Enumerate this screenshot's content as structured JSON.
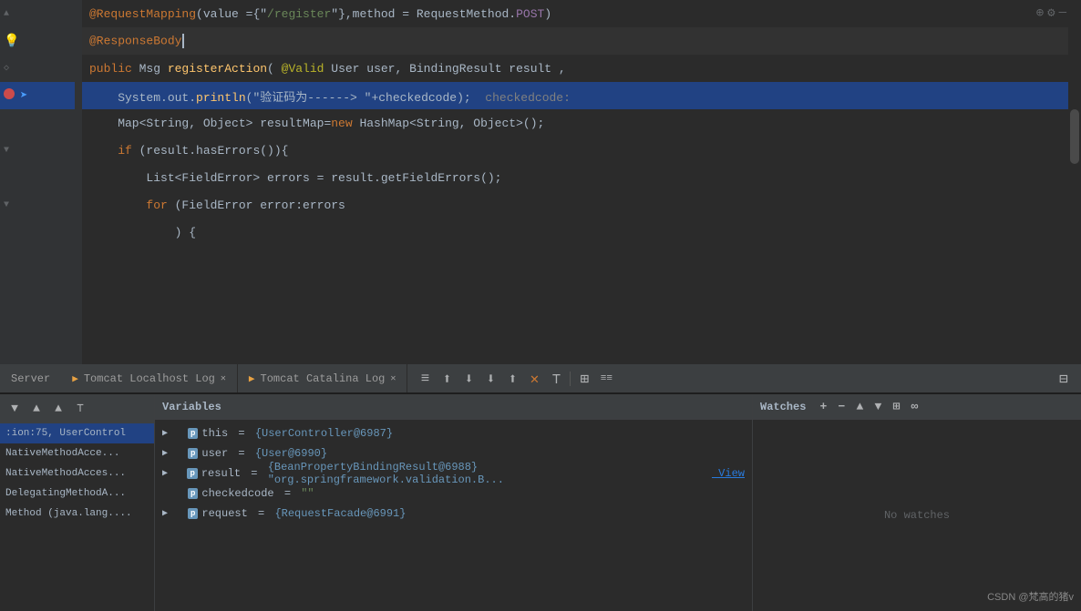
{
  "editor": {
    "lines": [
      {
        "gutter_label": "",
        "code": "<span class='kw-annotation'>@RequestMapping</span><span class='kw-gray'>(value ={\"</span><span class='kw-string'>/register</span><span class='kw-gray'>\"}</span><span class='kw-gray'>,method = RequestMethod.</span><span class='kw-purple'>POST</span><span class='kw-gray'>)</span>",
        "has_fold_arrow": true,
        "fold_direction": "up"
      },
      {
        "gutter_label": "",
        "code": "<span class='kw-annotation'>@ResponseBody</span>",
        "has_bulb": true,
        "is_active": true
      },
      {
        "gutter_label": "",
        "code": "<span class='kw-public'>public</span> <span class='kw-gray'>Msg</span> <span class='kw-method'>registerAction</span><span class='kw-gray'>( </span><span class='kw-annotation-name'>@Valid</span><span class='kw-gray'> User user, BindingResult result ,</span>",
        "has_fold_arrow": true,
        "fold_direction": "none"
      },
      {
        "gutter_label": "",
        "code": "<span class='kw-gray'>    System.out.</span><span class='kw-method'>println</span><span class='kw-gray'>(\"验证码为------&gt; \"+checkedcode);</span>  <span class='kw-comment'>checkedcode:</span>",
        "highlighted": true,
        "has_breakpoint": true,
        "has_debug_arrow": true
      },
      {
        "gutter_label": "",
        "code": "<span class='kw-gray'>    Map&lt;String, Object&gt; resultMap=</span><span class='kw-new'>new</span><span class='kw-gray'> HashMap&lt;String, Object&gt;();</span>"
      },
      {
        "gutter_label": "",
        "code": "<span class='kw-if'>    if</span><span class='kw-gray'> (result.hasErrors()){</span>",
        "has_fold_arrow": true,
        "fold_direction": "down"
      },
      {
        "gutter_label": "",
        "code": "<span class='kw-gray'>        List&lt;FieldError&gt; errors = result.getFieldErrors();</span>"
      },
      {
        "gutter_label": "",
        "code": "<span class='kw-for'>        for</span><span class='kw-gray'> (FieldError error:errors</span>",
        "has_fold_arrow": true,
        "fold_direction": "down"
      },
      {
        "gutter_label": "",
        "code": "<span class='kw-gray'>            ) {</span>"
      }
    ]
  },
  "toolbar": {
    "icons": [
      "⊕",
      "⚙",
      "—"
    ],
    "tabs": [
      {
        "label": "Server",
        "is_server": true
      },
      {
        "label": "Tomcat Localhost Log",
        "active": false,
        "has_close": true
      },
      {
        "label": "Tomcat Catalina Log",
        "active": false,
        "has_close": true
      }
    ],
    "action_icons": [
      "≡",
      "↑",
      "↓",
      "↓",
      "↑",
      "✕",
      "⊤",
      "⊞",
      "≡≡",
      "⊞"
    ]
  },
  "debug_panel": {
    "callstack": {
      "header": "Variables",
      "items": [
        {
          "label": ":ion:75, UserControl",
          "selected": true
        },
        {
          "label": "NativeMethodAcce..."
        },
        {
          "label": "NativeMethodAcces..."
        },
        {
          "label": "DelegatingMethodA..."
        },
        {
          "label": "Method (java.lang...."
        }
      ]
    },
    "variables": {
      "header": "Variables",
      "items": [
        {
          "name": "this",
          "value": "{UserController@6987}",
          "type": "p",
          "has_expand": true
        },
        {
          "name": "user",
          "value": "{User@6990}",
          "type": "p",
          "has_expand": true
        },
        {
          "name": "result",
          "value": "{BeanPropertyBindingResult@6988} \"org.springframework.validation.B...",
          "type": "p",
          "has_expand": true,
          "has_view": true
        },
        {
          "name": "checkedcode",
          "value": "\"\"",
          "type": "p",
          "has_expand": false
        },
        {
          "name": "request",
          "value": "{RequestFacade@6991}",
          "type": "p",
          "has_expand": true
        }
      ]
    },
    "watches": {
      "header": "Watches",
      "empty_label": "No watches",
      "toolbar_icons": [
        "+",
        "−",
        "▲",
        "▼",
        "⊞",
        "∞"
      ]
    }
  },
  "watermark": "CSDN @梵高的猪v"
}
